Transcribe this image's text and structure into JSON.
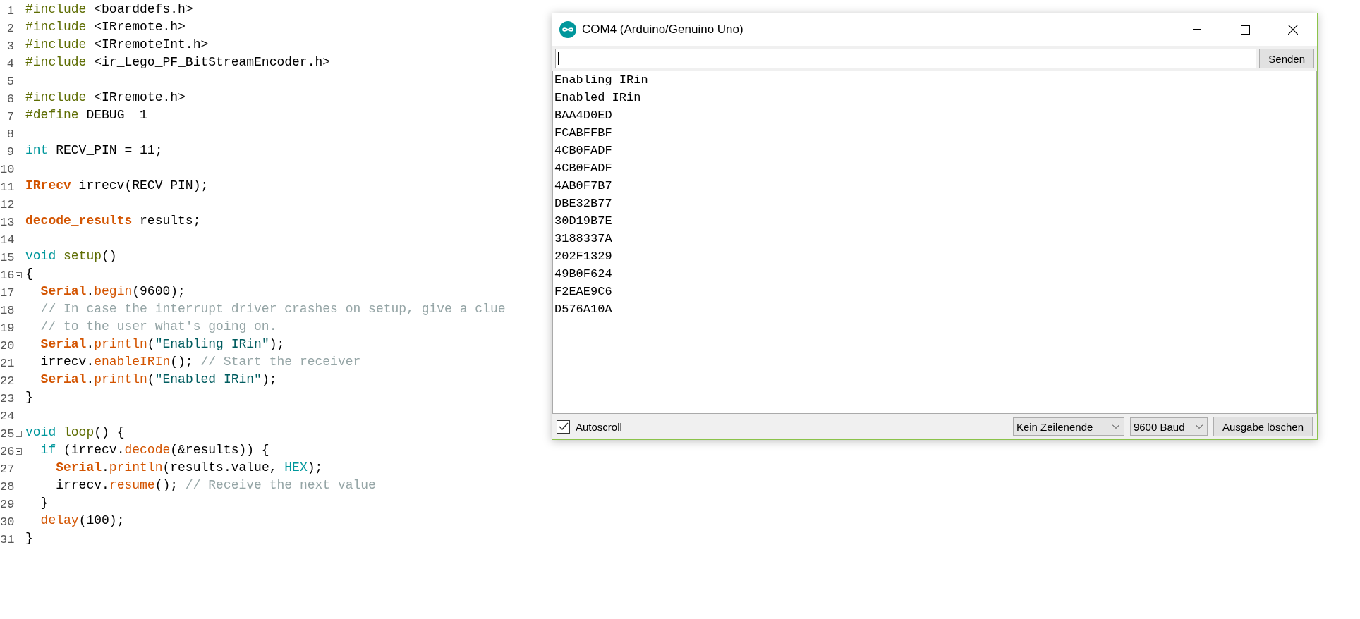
{
  "editor": {
    "lines": [
      {
        "number": "1",
        "fold": false,
        "tokens": [
          {
            "text": "#include",
            "kind": "preprocessor"
          },
          {
            "text": " <boarddefs.h>",
            "kind": "plain"
          }
        ]
      },
      {
        "number": "2",
        "fold": false,
        "tokens": [
          {
            "text": "#include",
            "kind": "preprocessor"
          },
          {
            "text": " <IRremote.h>",
            "kind": "plain"
          }
        ]
      },
      {
        "number": "3",
        "fold": false,
        "tokens": [
          {
            "text": "#include",
            "kind": "preprocessor"
          },
          {
            "text": " <IRremoteInt.h>",
            "kind": "plain"
          }
        ]
      },
      {
        "number": "4",
        "fold": false,
        "tokens": [
          {
            "text": "#include",
            "kind": "preprocessor"
          },
          {
            "text": " <ir_Lego_PF_BitStreamEncoder.h>",
            "kind": "plain"
          }
        ]
      },
      {
        "number": "5",
        "fold": false
      },
      {
        "number": "6",
        "fold": false,
        "tokens": [
          {
            "text": "#include",
            "kind": "preprocessor"
          },
          {
            "text": " <IRremote.h>",
            "kind": "plain"
          }
        ]
      },
      {
        "number": "7",
        "fold": false,
        "tokens": [
          {
            "text": "#define",
            "kind": "preprocessor"
          },
          {
            "text": " DEBUG  1",
            "kind": "plain"
          }
        ]
      },
      {
        "number": "8",
        "fold": false
      },
      {
        "number": "9",
        "fold": false,
        "tokens": [
          {
            "text": "int",
            "kind": "keyword"
          },
          {
            "text": " RECV_PIN = 11;",
            "kind": "plain"
          }
        ]
      },
      {
        "number": "10",
        "fold": false
      },
      {
        "number": "11",
        "fold": false,
        "tokens": [
          {
            "text": "IRrecv",
            "kind": "class"
          },
          {
            "text": " irrecv(RECV_PIN);",
            "kind": "plain"
          }
        ]
      },
      {
        "number": "12",
        "fold": false
      },
      {
        "number": "13",
        "fold": false,
        "tokens": [
          {
            "text": "decode_results",
            "kind": "class"
          },
          {
            "text": " results;",
            "kind": "plain"
          }
        ]
      },
      {
        "number": "14",
        "fold": false
      },
      {
        "number": "15",
        "fold": false,
        "tokens": [
          {
            "text": "void",
            "kind": "keyword"
          },
          {
            "text": " setup",
            "kind": "sketch"
          },
          {
            "text": "()",
            "kind": "plain"
          }
        ]
      },
      {
        "number": "16",
        "fold": true,
        "tokens": [
          {
            "text": "{",
            "kind": "plain"
          }
        ]
      },
      {
        "number": "17",
        "fold": false,
        "tokens": [
          {
            "text": "  Serial",
            "kind": "class"
          },
          {
            "text": ".",
            "kind": "plain"
          },
          {
            "text": "begin",
            "kind": "function"
          },
          {
            "text": "(9600);",
            "kind": "plain"
          }
        ]
      },
      {
        "number": "18",
        "fold": false,
        "tokens": [
          {
            "text": "  // In case the interrupt driver crashes on setup, give a clue",
            "kind": "comment"
          }
        ]
      },
      {
        "number": "19",
        "fold": false,
        "tokens": [
          {
            "text": "  // to the user what's going on.",
            "kind": "comment"
          }
        ]
      },
      {
        "number": "20",
        "fold": false,
        "tokens": [
          {
            "text": "  Serial",
            "kind": "class"
          },
          {
            "text": ".",
            "kind": "plain"
          },
          {
            "text": "println",
            "kind": "function"
          },
          {
            "text": "(",
            "kind": "plain"
          },
          {
            "text": "\"Enabling IRin\"",
            "kind": "string"
          },
          {
            "text": ");",
            "kind": "plain"
          }
        ]
      },
      {
        "number": "21",
        "fold": false,
        "tokens": [
          {
            "text": "  irrecv.",
            "kind": "plain"
          },
          {
            "text": "enableIRIn",
            "kind": "function"
          },
          {
            "text": "(); ",
            "kind": "plain"
          },
          {
            "text": "// Start the receiver",
            "kind": "comment"
          }
        ]
      },
      {
        "number": "22",
        "fold": false,
        "tokens": [
          {
            "text": "  Serial",
            "kind": "class"
          },
          {
            "text": ".",
            "kind": "plain"
          },
          {
            "text": "println",
            "kind": "function"
          },
          {
            "text": "(",
            "kind": "plain"
          },
          {
            "text": "\"Enabled IRin\"",
            "kind": "string"
          },
          {
            "text": ");",
            "kind": "plain"
          }
        ]
      },
      {
        "number": "23",
        "fold": false,
        "tokens": [
          {
            "text": "}",
            "kind": "plain"
          }
        ]
      },
      {
        "number": "24",
        "fold": false
      },
      {
        "number": "25",
        "fold": true,
        "tokens": [
          {
            "text": "void",
            "kind": "keyword"
          },
          {
            "text": " loop",
            "kind": "sketch"
          },
          {
            "text": "() {",
            "kind": "plain"
          }
        ]
      },
      {
        "number": "26",
        "fold": true,
        "tokens": [
          {
            "text": "  if",
            "kind": "keyword"
          },
          {
            "text": " (irrecv.",
            "kind": "plain"
          },
          {
            "text": "decode",
            "kind": "function"
          },
          {
            "text": "(&results)) {",
            "kind": "plain"
          }
        ]
      },
      {
        "number": "27",
        "fold": false,
        "tokens": [
          {
            "text": "    Serial",
            "kind": "class"
          },
          {
            "text": ".",
            "kind": "plain"
          },
          {
            "text": "println",
            "kind": "function"
          },
          {
            "text": "(results.value, ",
            "kind": "plain"
          },
          {
            "text": "HEX",
            "kind": "keyword"
          },
          {
            "text": ");",
            "kind": "plain"
          }
        ]
      },
      {
        "number": "28",
        "fold": false,
        "tokens": [
          {
            "text": "    irrecv.",
            "kind": "plain"
          },
          {
            "text": "resume",
            "kind": "function"
          },
          {
            "text": "(); ",
            "kind": "plain"
          },
          {
            "text": "// Receive the next value",
            "kind": "comment"
          }
        ]
      },
      {
        "number": "29",
        "fold": false,
        "tokens": [
          {
            "text": "  }",
            "kind": "plain"
          }
        ]
      },
      {
        "number": "30",
        "fold": false,
        "tokens": [
          {
            "text": "  delay",
            "kind": "function"
          },
          {
            "text": "(100);",
            "kind": "plain"
          }
        ]
      },
      {
        "number": "31",
        "fold": false,
        "tokens": [
          {
            "text": "}",
            "kind": "plain"
          }
        ]
      }
    ]
  },
  "serial_monitor": {
    "window": {
      "title": "COM4 (Arduino/Genuino Uno)"
    },
    "send_button": "Senden",
    "output": [
      "Enabling IRin",
      "Enabled IRin",
      "BAA4D0ED",
      "FCABFFBF",
      "4CB0FADF",
      "4CB0FADF",
      "4AB0F7B7",
      "DBE32B77",
      "30D19B7E",
      "3188337A",
      "202F1329",
      "49B0F624",
      "F2EAE9C6",
      "D576A10A"
    ],
    "autoscroll": {
      "label": "Autoscroll",
      "checked": true
    },
    "line_ending": "Kein Zeilenende",
    "baud_rate": "9600 Baud",
    "clear_button": "Ausgabe löschen"
  }
}
